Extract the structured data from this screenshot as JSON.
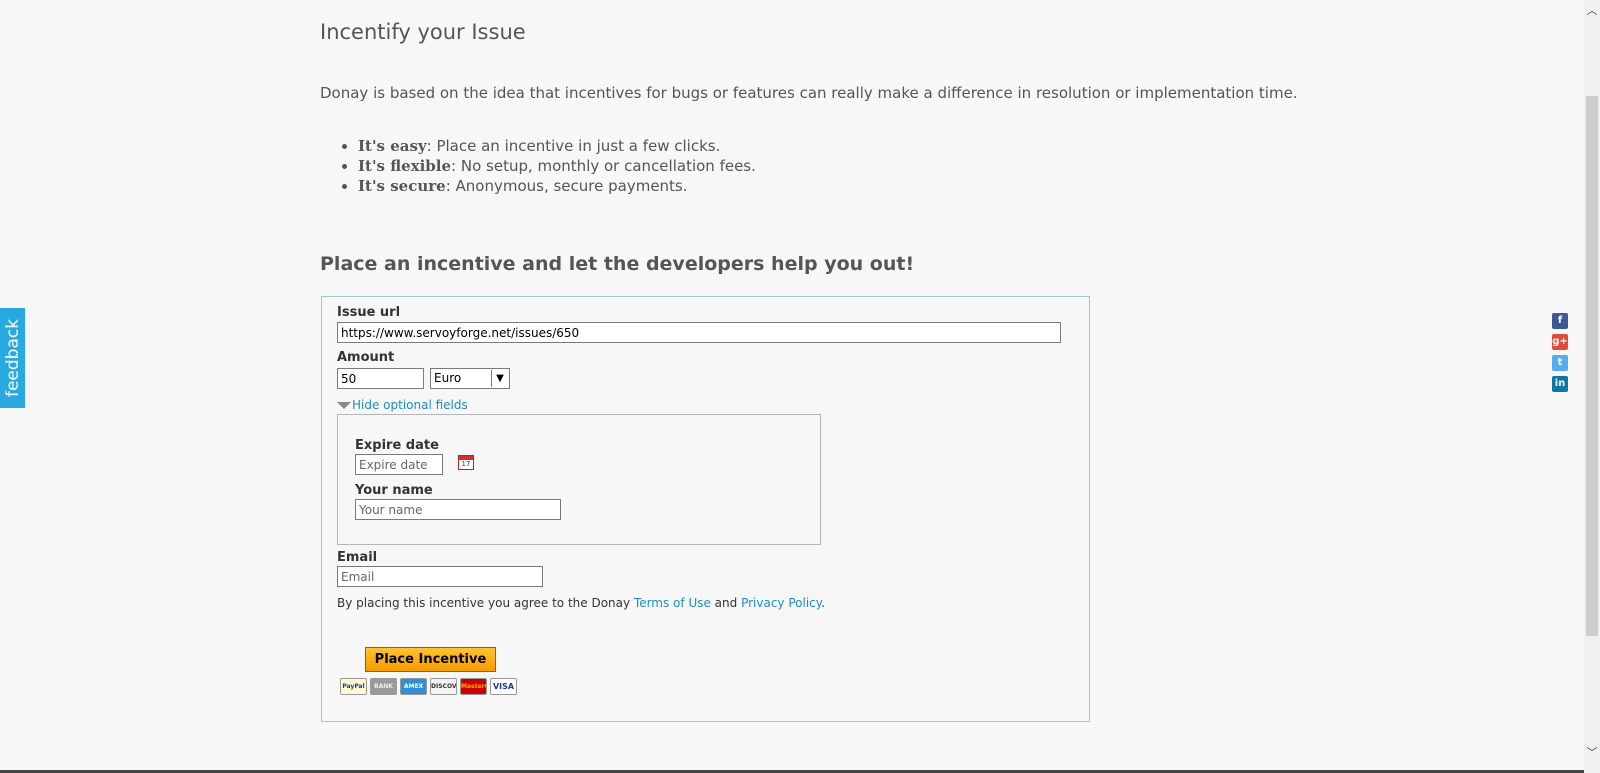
{
  "page": {
    "title": "Incentify your Issue",
    "intro": "Donay is based on the idea that incentives for bugs or features can really make a difference in resolution or implementation time.",
    "features": [
      {
        "bold": "It's easy",
        "text": ": Place an incentive in just a few clicks."
      },
      {
        "bold": "It's flexible",
        "text": ": No setup, monthly or cancellation fees."
      },
      {
        "bold": "It's secure",
        "text": ": Anonymous, secure payments."
      }
    ],
    "cta_heading": "Place an incentive and let the developers help you out!"
  },
  "form": {
    "issue_url_label": "Issue url",
    "issue_url_value": "https://www.servoyforge.net/issues/650",
    "amount_label": "Amount",
    "amount_value": "50",
    "currency_selected": "Euro",
    "toggle_label": "Hide optional fields",
    "expire_label": "Expire date",
    "expire_placeholder": "Expire date",
    "calendar_day": "17",
    "name_label": "Your name",
    "name_placeholder": "Your name",
    "email_label": "Email",
    "email_placeholder": "Email",
    "terms_prefix": "By placing this incentive you agree to the Donay ",
    "terms_link": "Terms of Use",
    "terms_and": " and ",
    "privacy_link": "Privacy Policy",
    "terms_suffix": ".",
    "submit_label": "Place Incentive",
    "payment_methods": [
      "PayPal",
      "BANK",
      "AMEX",
      "DISCOVER",
      "MasterCard",
      "VISA"
    ]
  },
  "feedback": {
    "label": "feedback"
  },
  "social": {
    "icons": [
      "facebook-icon",
      "google-plus-icon",
      "twitter-icon",
      "linkedin-icon"
    ],
    "glyphs": [
      "f",
      "g+",
      "t",
      "in"
    ],
    "colors": [
      "#3b5998",
      "#dd4b39",
      "#55acee",
      "#0e76a8"
    ]
  },
  "colors": {
    "accent": "#1e8bc3",
    "button": "#f59c00",
    "feedback": "#29a9e1"
  }
}
